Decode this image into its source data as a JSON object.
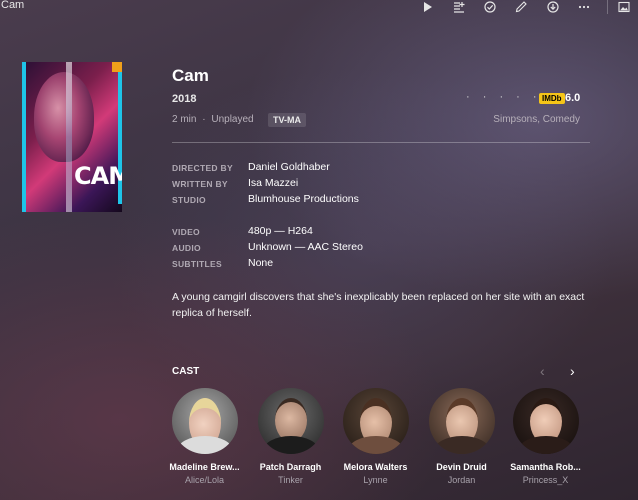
{
  "app": {
    "title": "Cam"
  },
  "toolbar": {
    "icons": [
      "play-icon",
      "add-to-queue-icon",
      "mark-watched-icon",
      "edit-icon",
      "download-icon",
      "more-icon",
      "image-icon"
    ]
  },
  "movie": {
    "title": "Cam",
    "year": "2018",
    "rating_dots": "· · · · ·",
    "imdb_label": "IMDb",
    "imdb_score": "6.0",
    "duration": "2 min",
    "separator": "·",
    "play_status": "Unplayed",
    "content_rating": "TV-MA",
    "genres": "Simpsons, Comedy",
    "summary": "A young camgirl discovers that she's inexplicably been replaced on her site with an exact replica of herself."
  },
  "poster": {
    "title_text": "CAM"
  },
  "details": {
    "directed_by_label": "DIRECTED BY",
    "directed_by": "Daniel Goldhaber",
    "written_by_label": "WRITTEN BY",
    "written_by": "Isa Mazzei",
    "studio_label": "STUDIO",
    "studio": "Blumhouse Productions",
    "video_label": "VIDEO",
    "video": "480p — H264",
    "audio_label": "AUDIO",
    "audio": "Unknown — AAC Stereo",
    "subtitles_label": "SUBTITLES",
    "subtitles": "None"
  },
  "cast": {
    "label": "CAST",
    "prev_arrow": "‹",
    "next_arrow": "›",
    "members": [
      {
        "name": "Madeline Brew...",
        "role": "Alice/Lola"
      },
      {
        "name": "Patch Darragh",
        "role": "Tinker"
      },
      {
        "name": "Melora Walters",
        "role": "Lynne"
      },
      {
        "name": "Devin Druid",
        "role": "Jordan"
      },
      {
        "name": "Samantha Rob...",
        "role": "Princess_X"
      }
    ]
  },
  "colors": {
    "imdb_yellow": "#f5c518",
    "poster_accent": "#1ec4e8"
  }
}
